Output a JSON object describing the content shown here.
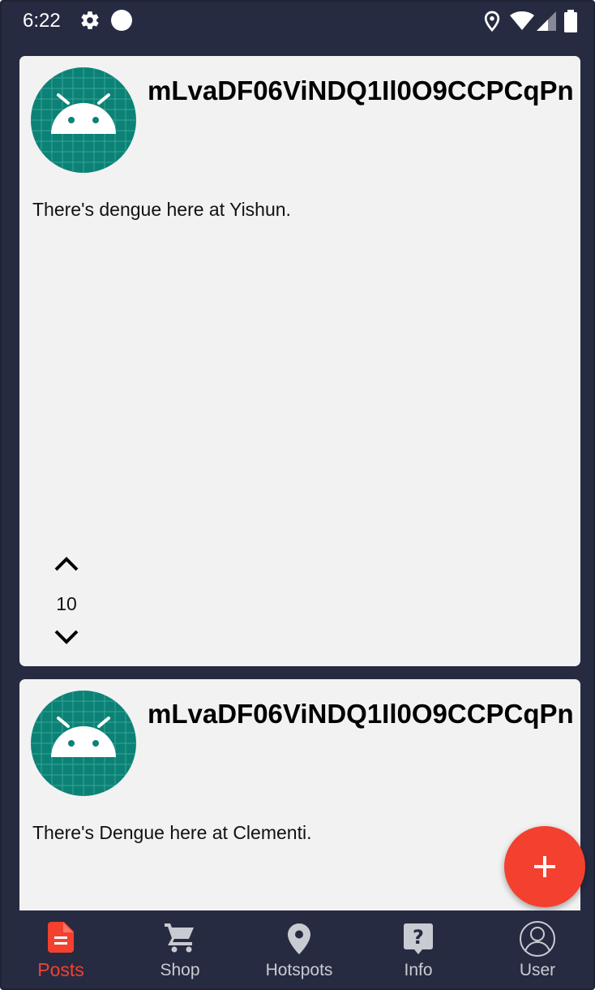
{
  "status_bar": {
    "time": "6:22",
    "icons": [
      "gear-icon",
      "circle-icon",
      "location-pin-icon",
      "wifi-icon",
      "signal-icon",
      "battery-icon"
    ]
  },
  "posts": [
    {
      "username": "mLvaDF06ViNDQ1Il0O9CCPCqPn",
      "text": "There's dengue here at Yishun.",
      "votes": "10",
      "avatar_icon": "android-robot-icon"
    },
    {
      "username": "mLvaDF06ViNDQ1Il0O9CCPCqPn",
      "text": "There's Dengue here at Clementi.",
      "avatar_icon": "android-robot-icon"
    }
  ],
  "fab": {
    "icon": "plus-icon"
  },
  "bottom_nav": {
    "items": [
      {
        "label": "Posts",
        "icon": "document-icon",
        "active": true
      },
      {
        "label": "Shop",
        "icon": "cart-icon",
        "active": false
      },
      {
        "label": "Hotspots",
        "icon": "map-pin-icon",
        "active": false
      },
      {
        "label": "Info",
        "icon": "question-icon",
        "active": false
      },
      {
        "label": "User",
        "icon": "user-circle-icon",
        "active": false
      }
    ]
  },
  "colors": {
    "background": "#262b41",
    "card": "#f2f2f2",
    "accent": "#f4402f",
    "avatar": "#0b8275",
    "nav_inactive": "#c9cbd2"
  }
}
